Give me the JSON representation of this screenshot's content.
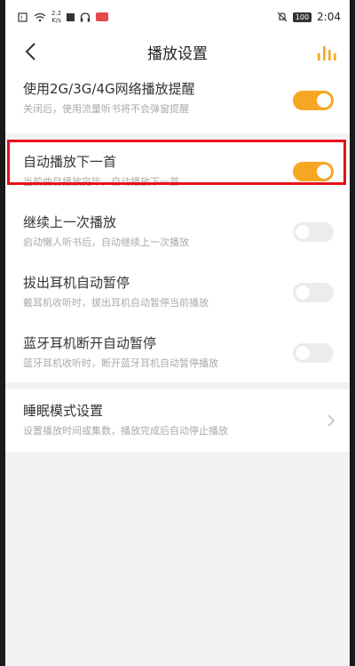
{
  "status_bar": {
    "speed_top": "2.2",
    "speed_bottom": "K/s",
    "battery": "100",
    "time": "2:04"
  },
  "header": {
    "title": "播放设置"
  },
  "settings": [
    {
      "title": "使用2G/3G/4G网络播放提醒",
      "subtitle": "关闭后，使用流量听书将不会弹窗提醒",
      "enabled": true
    },
    {
      "title": "自动播放下一首",
      "subtitle": "当前曲目播放完毕，自动播放下一首",
      "enabled": true
    },
    {
      "title": "继续上一次播放",
      "subtitle": "启动懒人听书后，自动继续上一次播放",
      "enabled": false
    },
    {
      "title": "拔出耳机自动暂停",
      "subtitle": "戴耳机收听时，拔出耳机自动暂停当前播放",
      "enabled": false
    },
    {
      "title": "蓝牙耳机断开自动暂停",
      "subtitle": "蓝牙耳机收听时，断开蓝牙耳机自动暂停播放",
      "enabled": false
    }
  ],
  "sleep_mode": {
    "title": "睡眠模式设置",
    "subtitle": "设置播放时间或集数，播放完成后自动停止播放"
  },
  "colors": {
    "accent": "#f5a623",
    "highlight_border": "#e8101a"
  }
}
